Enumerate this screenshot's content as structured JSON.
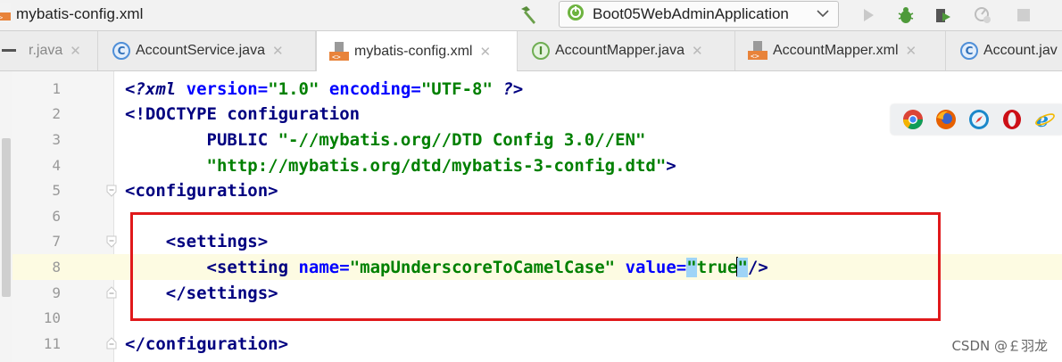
{
  "window": {
    "file_title": "mybatis-config.xml"
  },
  "toolbar": {
    "run_config": "Boot05WebAdminApplication"
  },
  "tabs": [
    {
      "label": "r.java",
      "icon": "java-class-icon"
    },
    {
      "label": "AccountService.java",
      "icon": "class-icon"
    },
    {
      "label": "mybatis-config.xml",
      "icon": "xml-icon",
      "active": true
    },
    {
      "label": "AccountMapper.java",
      "icon": "interface-icon"
    },
    {
      "label": "AccountMapper.xml",
      "icon": "xml-icon"
    },
    {
      "label": "Account.jav",
      "icon": "class-icon"
    }
  ],
  "icon_badges": {
    "class": "C",
    "interface": "I"
  },
  "editor": {
    "line_numbers": [
      "1",
      "2",
      "3",
      "4",
      "5",
      "6",
      "7",
      "8",
      "9",
      "10",
      "11"
    ],
    "lines": {
      "l1": {
        "open": "<?",
        "name": "xml",
        "a1": "version",
        "eq1": "=",
        "v1": "\"1.0\"",
        "a2": "encoding",
        "eq2": "=",
        "v2": "\"UTF-8\"",
        "close": "?>"
      },
      "l2": {
        "doctype": "<!DOCTYPE",
        "root": "configuration"
      },
      "l3": {
        "kw": "PUBLIC",
        "id": "\"-//mybatis.org//DTD Config 3.0//EN\""
      },
      "l4": {
        "dtd": "\"http://mybatis.org/dtd/mybatis-3-config.dtd\"",
        "close": ">"
      },
      "l5": {
        "tag": "<configuration>"
      },
      "l7": {
        "tag": "<settings>"
      },
      "l8": {
        "open": "<setting",
        "a1": "name",
        "eq1": "=",
        "v1": "\"mapUnderscoreToCamelCase\"",
        "a2": "value",
        "eq2": "=",
        "q_open": "\"",
        "v2": "true",
        "q_close": "\"",
        "close": "/>"
      },
      "l9": {
        "tag": "</settings>"
      },
      "l11": {
        "tag": "</configuration>"
      }
    }
  },
  "browser_icons": [
    "chrome-icon",
    "firefox-icon",
    "safari-icon",
    "opera-icon",
    "ie-icon"
  ],
  "browser_colors": {
    "chrome": "#db4437",
    "firefox": "#e66000",
    "safari": "#1b88ca",
    "opera": "#cc0f16",
    "ie": "#1e90d8"
  },
  "annotation_color": "#e0191b",
  "watermark": "CSDN @￡羽龙"
}
